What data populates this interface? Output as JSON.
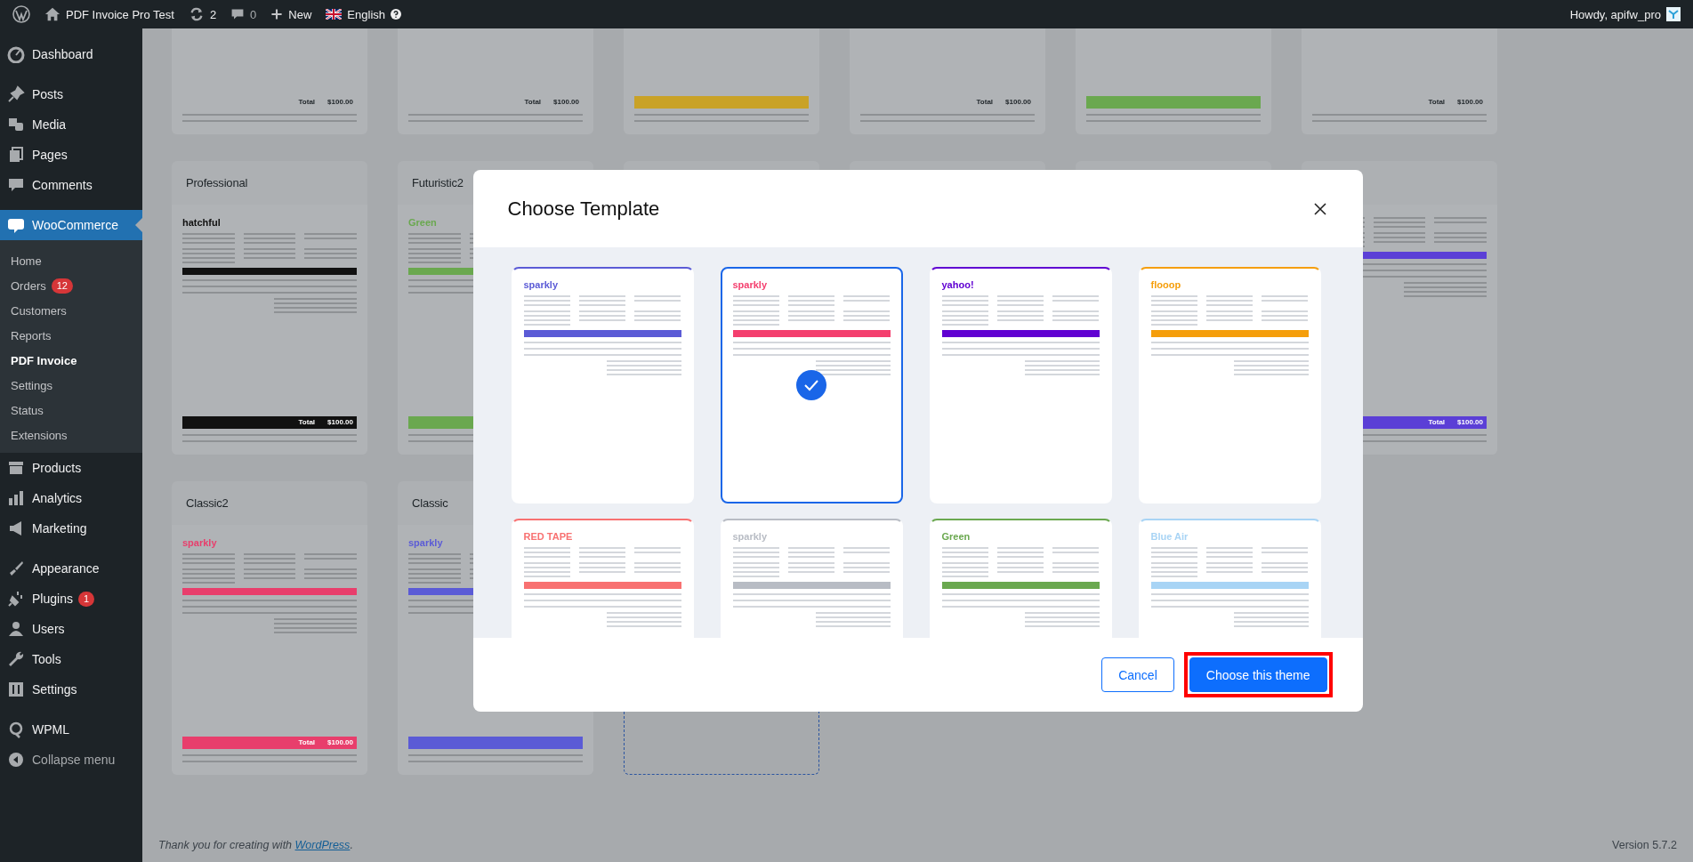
{
  "admin_bar": {
    "site_name": "PDF Invoice Pro Test",
    "updates": "2",
    "comments": "0",
    "new": "New",
    "language": "English",
    "greeting": "Howdy, apifw_pro"
  },
  "sidebar": {
    "groups": [
      [
        {
          "kind": "menu",
          "label": "Dashboard",
          "selected": false
        }
      ],
      [
        {
          "kind": "menu",
          "label": "Posts",
          "selected": false
        },
        {
          "kind": "menu",
          "label": "Media",
          "selected": false
        },
        {
          "kind": "menu",
          "label": "Pages",
          "selected": false
        },
        {
          "kind": "menu",
          "label": "Comments",
          "selected": false
        }
      ],
      [
        {
          "kind": "menu",
          "label": "WooCommerce",
          "selected": true,
          "children": [
            {
              "label": "Home",
              "selected": false
            },
            {
              "label": "Orders",
              "badge": "12",
              "selected": false
            },
            {
              "label": "Customers",
              "selected": false
            },
            {
              "label": "Reports",
              "selected": false
            },
            {
              "label": "PDF Invoice",
              "selected": true
            },
            {
              "label": "Settings",
              "selected": false
            },
            {
              "label": "Status",
              "selected": false
            },
            {
              "label": "Extensions",
              "selected": false
            }
          ]
        },
        {
          "kind": "menu",
          "label": "Products",
          "selected": false
        },
        {
          "kind": "menu",
          "label": "Analytics",
          "selected": false
        },
        {
          "kind": "menu",
          "label": "Marketing",
          "selected": false
        }
      ],
      [
        {
          "kind": "menu",
          "label": "Appearance",
          "selected": false
        },
        {
          "kind": "menu",
          "label": "Plugins",
          "badge": "1",
          "selected": false
        },
        {
          "kind": "menu",
          "label": "Users",
          "selected": false
        },
        {
          "kind": "menu",
          "label": "Tools",
          "selected": false
        },
        {
          "kind": "menu",
          "label": "Settings",
          "selected": false
        }
      ],
      [
        {
          "kind": "menu",
          "label": "WPML",
          "selected": false
        },
        {
          "kind": "collapse",
          "label": "Collapse menu",
          "selected": false
        }
      ]
    ]
  },
  "background_cards": [
    {
      "kind": "card",
      "total_label": "Total",
      "total_value": "$100.00"
    },
    {
      "kind": "card",
      "total_label": "Total",
      "total_value": "$100.00"
    },
    {
      "kind": "card",
      "color": "#c9a227"
    },
    {
      "kind": "card",
      "total_label": "Total",
      "total_value": "$100.00"
    },
    {
      "kind": "card",
      "color": "#6aa84f"
    },
    {
      "kind": "card",
      "total_label": "Total",
      "total_value": "$100.00"
    },
    {
      "kind": "card",
      "title": "Professional",
      "logo": "hatchful",
      "color": "#111111",
      "total_label": "Total",
      "total_value": "$100.00"
    },
    {
      "kind": "card",
      "title": "Futuristic2",
      "logo": "Green",
      "color": "#6aa84f"
    },
    {
      "kind": "card"
    },
    {
      "kind": "card"
    },
    {
      "kind": "card"
    },
    {
      "kind": "card",
      "color": "#5b3fd6",
      "total_label": "Total",
      "total_value": "$100.00"
    },
    {
      "kind": "card",
      "title": "Classic2",
      "logo": "sparkly",
      "color": "#e83e6c",
      "total_label": "Total",
      "total_value": "$100.00"
    },
    {
      "kind": "card",
      "title": "Classic",
      "logo": "sparkly",
      "color": "#5b5bd6"
    },
    {
      "kind": "add"
    }
  ],
  "modal": {
    "title": "Choose Template",
    "templates": [
      {
        "logo": "sparkly",
        "color": "#5b5bd6",
        "selected": false
      },
      {
        "logo": "sparkly",
        "color": "#f43f6e",
        "selected": true
      },
      {
        "logo": "yahoo!",
        "color": "#6001d2",
        "selected": false
      },
      {
        "logo": "flooop",
        "color": "#f59e0b",
        "selected": false
      },
      {
        "logo": "RED TAPE",
        "color": "#f87171",
        "selected": false
      },
      {
        "logo": "sparkly",
        "color": "#b8bcc4",
        "selected": false
      },
      {
        "logo": "Green",
        "color": "#6aa84f",
        "selected": false
      },
      {
        "logo": "Blue Air",
        "color": "#a8d4f5",
        "selected": false
      }
    ],
    "buttons": [
      {
        "kind": "secondary",
        "label": "Cancel"
      },
      {
        "kind": "primary",
        "label": "Choose this theme",
        "highlighted": true
      }
    ]
  },
  "footer": {
    "text_before": "Thank you for creating with ",
    "link": "WordPress",
    "text_after": ".",
    "version": "Version 5.7.2"
  }
}
